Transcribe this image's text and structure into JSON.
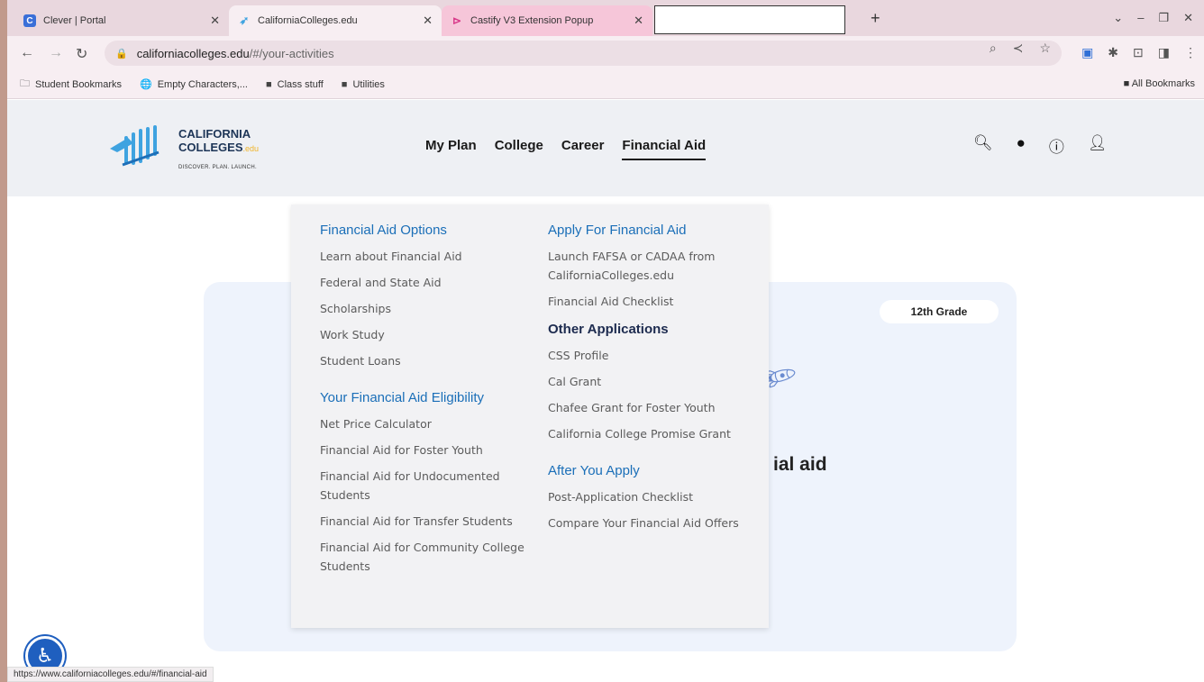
{
  "tabs": [
    {
      "title": "Clever | Portal",
      "favicon": "C"
    },
    {
      "title": "CaliforniaColleges.edu"
    },
    {
      "title": "Castify V3 Extension Popup"
    }
  ],
  "address": {
    "host": "californiacolleges.edu",
    "path": "/#/your-activities"
  },
  "bookmarks": [
    {
      "label": "Student Bookmarks"
    },
    {
      "label": "Empty Characters,..."
    },
    {
      "label": "Class stuff"
    },
    {
      "label": "Utilities"
    }
  ],
  "all_bookmarks": "All Bookmarks",
  "logo": {
    "line1": "CALIFORNIA",
    "line2": "COLLEGES",
    "edu": ".edu",
    "tagline": "DISCOVER. PLAN. LAUNCH."
  },
  "nav": [
    "My Plan",
    "College",
    "Career",
    "Financial Aid"
  ],
  "card": {
    "grade": "12th Grade",
    "partial_text": "ial aid"
  },
  "dropdown": {
    "left": {
      "sections": [
        {
          "heading": "Financial Aid Options",
          "links": [
            "Learn about Financial Aid",
            "Federal and State Aid",
            "Scholarships",
            "Work Study",
            "Student Loans"
          ]
        },
        {
          "heading": "Your Financial Aid Eligibility",
          "links": [
            "Net Price Calculator",
            "Financial Aid for Foster Youth",
            "Financial Aid for Undocumented Students",
            "Financial Aid for Transfer Students",
            "Financial Aid for Community College Students"
          ]
        }
      ]
    },
    "right": {
      "sections": [
        {
          "heading": "Apply For Financial Aid",
          "links": [
            "Launch FAFSA or CADAA from CaliforniaColleges.edu",
            "Financial Aid Checklist"
          ]
        },
        {
          "heading": "Other Applications",
          "links": [
            "CSS Profile",
            "Cal Grant",
            "Chafee Grant for Foster Youth",
            "California College Promise Grant"
          ]
        },
        {
          "heading": "After You Apply",
          "links": [
            "Post-Application Checklist",
            "Compare Your Financial Aid Offers"
          ]
        }
      ]
    }
  },
  "status_url": "https://www.californiacolleges.edu/#/financial-aid"
}
